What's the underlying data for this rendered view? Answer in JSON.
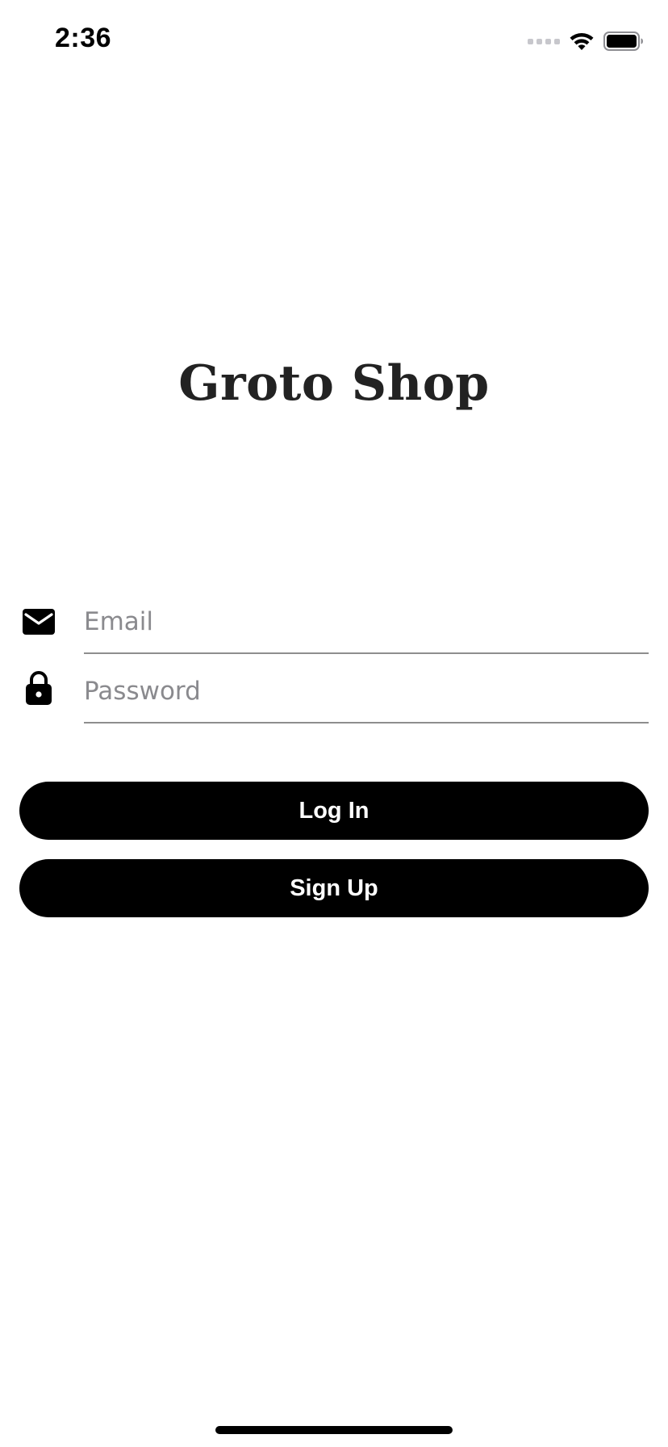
{
  "status_bar": {
    "time": "2:36",
    "signal_icon": "cellular-signal-icon",
    "wifi_icon": "wifi-icon",
    "battery_icon": "battery-icon"
  },
  "app": {
    "title": "Groto Shop"
  },
  "form": {
    "email": {
      "icon": "envelope-icon",
      "placeholder": "Email",
      "value": ""
    },
    "password": {
      "icon": "lock-icon",
      "placeholder": "Password",
      "value": ""
    }
  },
  "buttons": {
    "login_label": "Log In",
    "signup_label": "Sign Up"
  },
  "colors": {
    "background": "#ffffff",
    "button_bg": "#000000",
    "button_text": "#ffffff",
    "title_text": "#222222",
    "placeholder": "#8a8a8e",
    "divider": "#8e8e8e"
  }
}
